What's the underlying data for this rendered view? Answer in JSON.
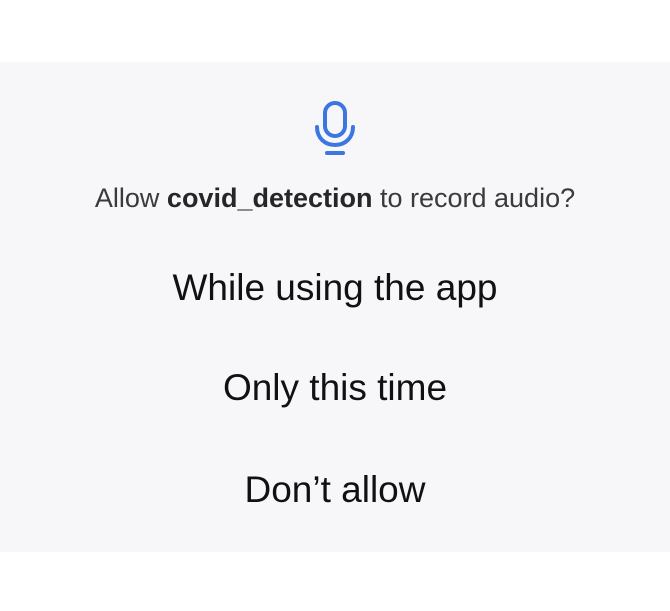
{
  "dialog": {
    "icon": "microphone-icon",
    "accent_color": "#3c76e0",
    "prompt_prefix": "Allow ",
    "app_name": "covid_detection",
    "prompt_suffix": " to record audio?",
    "options": [
      {
        "label": "While using the app"
      },
      {
        "label": "Only this time"
      },
      {
        "label": "Don’t allow"
      }
    ]
  }
}
